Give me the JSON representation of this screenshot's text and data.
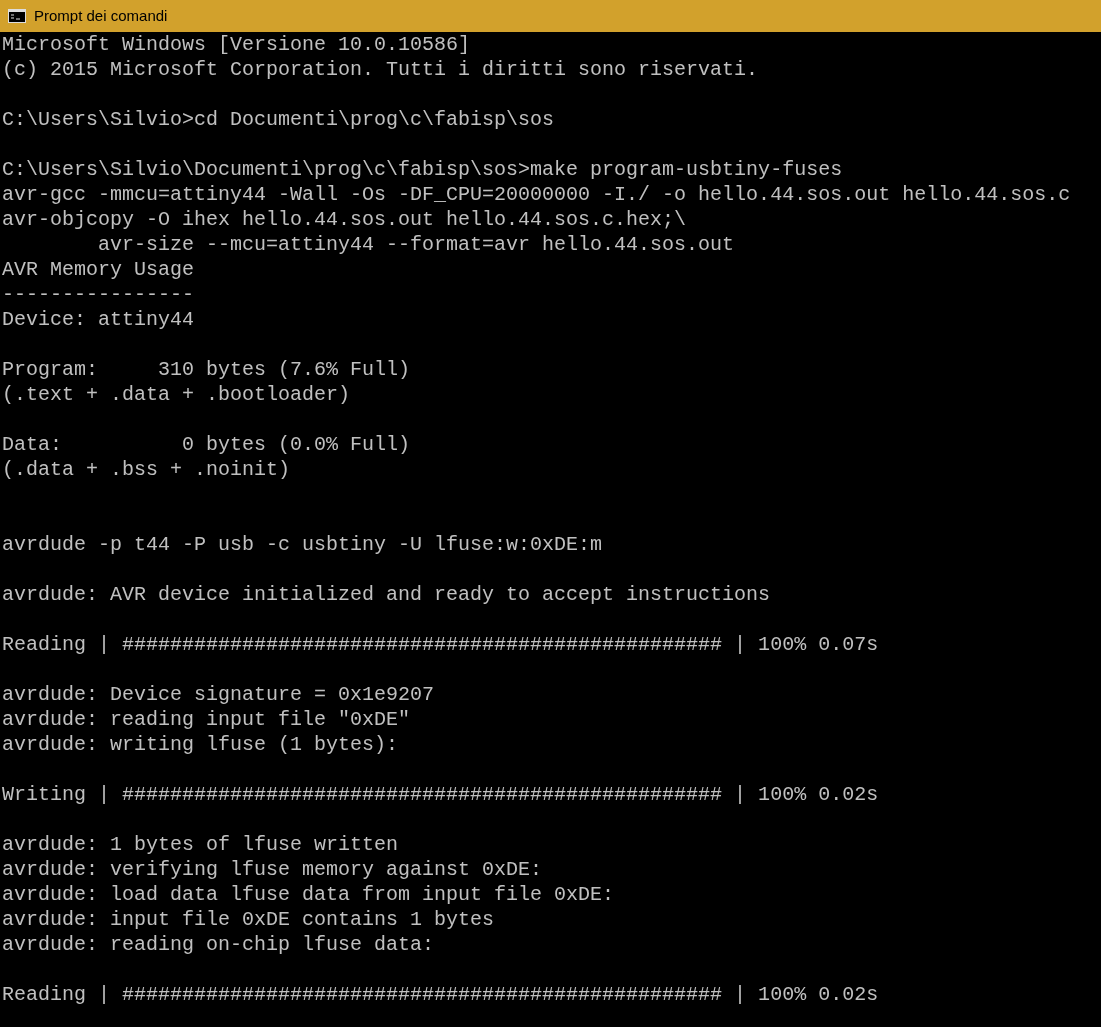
{
  "window": {
    "title": "Prompt dei comandi"
  },
  "lines": [
    {
      "kind": "text",
      "text": "Microsoft Windows [Versione 10.0.10586]"
    },
    {
      "kind": "text",
      "text": "(c) 2015 Microsoft Corporation. Tutti i diritti sono riservati."
    },
    {
      "kind": "blank"
    },
    {
      "kind": "text",
      "text": "C:\\Users\\Silvio>cd Documenti\\prog\\c\\fabisp\\sos"
    },
    {
      "kind": "blank"
    },
    {
      "kind": "text",
      "text": "C:\\Users\\Silvio\\Documenti\\prog\\c\\fabisp\\sos>make program-usbtiny-fuses"
    },
    {
      "kind": "text",
      "text": "avr-gcc -mmcu=attiny44 -Wall -Os -DF_CPU=20000000 -I./ -o hello.44.sos.out hello.44.sos.c"
    },
    {
      "kind": "text",
      "text": "avr-objcopy -O ihex hello.44.sos.out hello.44.sos.c.hex;\\"
    },
    {
      "kind": "text",
      "text": "        avr-size --mcu=attiny44 --format=avr hello.44.sos.out"
    },
    {
      "kind": "text",
      "text": "AVR Memory Usage"
    },
    {
      "kind": "text",
      "text": "----------------"
    },
    {
      "kind": "text",
      "text": "Device: attiny44"
    },
    {
      "kind": "blank"
    },
    {
      "kind": "text",
      "text": "Program:     310 bytes (7.6% Full)"
    },
    {
      "kind": "text",
      "text": "(.text + .data + .bootloader)"
    },
    {
      "kind": "blank"
    },
    {
      "kind": "text",
      "text": "Data:          0 bytes (0.0% Full)"
    },
    {
      "kind": "text",
      "text": "(.data + .bss + .noinit)"
    },
    {
      "kind": "blank"
    },
    {
      "kind": "blank"
    },
    {
      "kind": "text",
      "text": "avrdude -p t44 -P usb -c usbtiny -U lfuse:w:0xDE:m"
    },
    {
      "kind": "blank"
    },
    {
      "kind": "text",
      "text": "avrdude: AVR device initialized and ready to accept instructions"
    },
    {
      "kind": "blank"
    },
    {
      "kind": "text",
      "text": "Reading | ################################################## | 100% 0.07s"
    },
    {
      "kind": "blank"
    },
    {
      "kind": "text",
      "text": "avrdude: Device signature = 0x1e9207"
    },
    {
      "kind": "text",
      "text": "avrdude: reading input file \"0xDE\""
    },
    {
      "kind": "text",
      "text": "avrdude: writing lfuse (1 bytes):"
    },
    {
      "kind": "blank"
    },
    {
      "kind": "text",
      "text": "Writing | ################################################## | 100% 0.02s"
    },
    {
      "kind": "blank"
    },
    {
      "kind": "text",
      "text": "avrdude: 1 bytes of lfuse written"
    },
    {
      "kind": "text",
      "text": "avrdude: verifying lfuse memory against 0xDE:"
    },
    {
      "kind": "text",
      "text": "avrdude: load data lfuse data from input file 0xDE:"
    },
    {
      "kind": "text",
      "text": "avrdude: input file 0xDE contains 1 bytes"
    },
    {
      "kind": "text",
      "text": "avrdude: reading on-chip lfuse data:"
    },
    {
      "kind": "blank"
    },
    {
      "kind": "text",
      "text": "Reading | ################################################## | 100% 0.02s"
    }
  ]
}
